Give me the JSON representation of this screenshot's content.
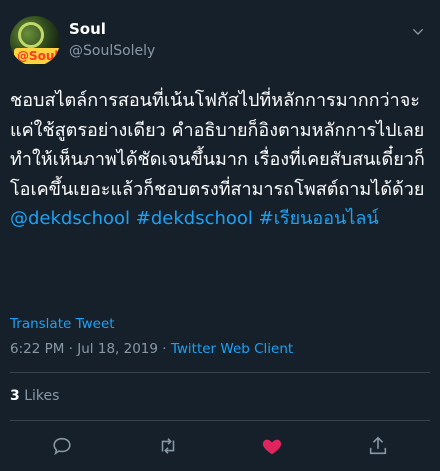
{
  "user": {
    "display_name": "Soul",
    "handle": "@SoulSolely",
    "avatar_text": "@Soul"
  },
  "tweet": {
    "text": "ชอบสไตล์การสอนที่เน้นโฟกัสไปที่หลักการมากกว่าจะแค่ใช้สูตรอย่างเดียว คำอธิบายก็อิงตามหลักการไปเลยทำให้เห็นภาพได้ชัดเจนขึ้นมาก เรื่องที่เคยสับสนเดี๋ยวก็โอเคขึ้นเยอะแล้วก็ชอบตรงที่สามารถโพสต์ถามได้ด้วย",
    "hashtags": [
      "@dekdschool",
      "#dekdschool",
      "#เรียนออนไลน์"
    ],
    "translate_label": "Translate Tweet",
    "timestamp": "6:22 PM · Jul 18, 2019",
    "separator": " · ",
    "client": "Twitter Web Client"
  },
  "stats": {
    "likes_count": "3",
    "likes_label": "Likes"
  },
  "colors": {
    "background": "#15202b",
    "accent": "#1da1f2",
    "muted": "#8899a6",
    "like": "#e0245e",
    "divider": "#38444d"
  },
  "icons": {
    "reply": "reply-icon",
    "retweet": "retweet-icon",
    "like": "heart-icon",
    "share": "share-icon",
    "more": "chevron-down-icon"
  }
}
